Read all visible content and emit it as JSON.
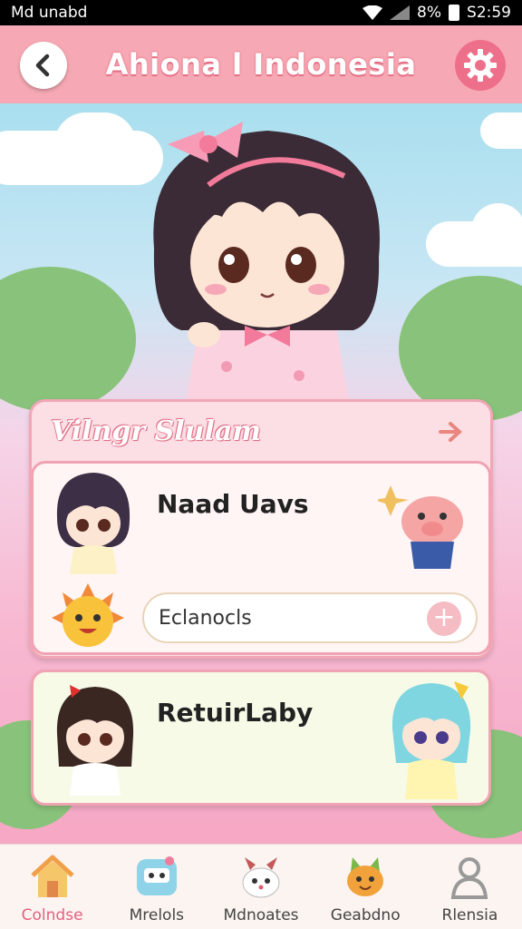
{
  "status_bar": {
    "left": "Md unabd",
    "battery": "8%",
    "time": "S2:59"
  },
  "header": {
    "title": "Ahiona l Indonesia"
  },
  "panel": {
    "title": "Vilngr Slulam",
    "card1": {
      "name": "Naad Uavs",
      "search_value": "Eclanocls"
    },
    "card2": {
      "name": "RetuirLaby"
    }
  },
  "bottom_nav": {
    "items": [
      {
        "label": "Colndse",
        "icon": "home-icon",
        "active": true
      },
      {
        "label": "Mrelols",
        "icon": "robot-icon",
        "active": false
      },
      {
        "label": "Mdnoates",
        "icon": "bunny-icon",
        "active": false
      },
      {
        "label": "Geabdno",
        "icon": "fox-icon",
        "active": false
      },
      {
        "label": "Rlensia",
        "icon": "person-icon",
        "active": false
      }
    ]
  },
  "colors": {
    "accent": "#f6a9b4",
    "accent_dark": "#ee6f8a",
    "panel_border": "#f0a3b3"
  }
}
